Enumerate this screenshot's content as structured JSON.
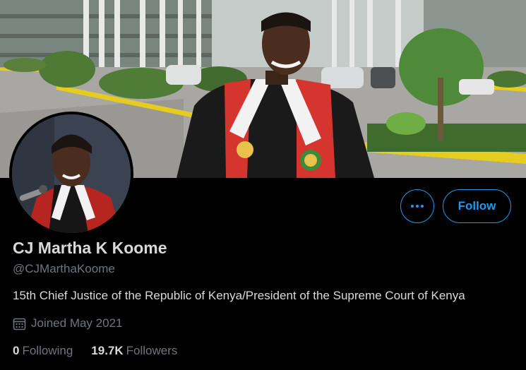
{
  "profile": {
    "name": "CJ Martha K Koome",
    "handle": "@CJMarthaKoome",
    "bio": "15th Chief Justice of the Republic of Kenya/President of the Supreme Court of Kenya",
    "joined": "Joined May 2021",
    "following_count": "0",
    "following_label": "Following",
    "followers_count": "19.7K",
    "followers_label": "Followers"
  },
  "actions": {
    "follow_label": "Follow",
    "more_icon": "more-dots-icon"
  },
  "icons": {
    "joined": "calendar-icon"
  },
  "colors": {
    "accent": "#1d9bf0",
    "background": "#000000",
    "primary_text": "#d9d9d9",
    "secondary_text": "#6e767d",
    "robe_red": "#d6342f"
  }
}
